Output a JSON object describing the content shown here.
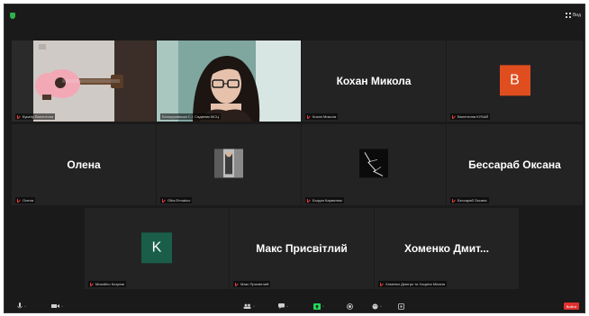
{
  "header": {
    "view_label": "Вид"
  },
  "participants": [
    {
      "id": "p1",
      "caption": "Кушнір Валентина",
      "display": "video",
      "muted": true
    },
    {
      "id": "p2",
      "caption": "Білоцерківська С.І. Садівник МСЦ",
      "display": "video",
      "muted": false,
      "active": true
    },
    {
      "id": "p3",
      "caption": "Кохан Микола",
      "display": "name",
      "name": "Кохан Микола",
      "muted": true
    },
    {
      "id": "p4",
      "caption": "Валентина КУБАЙ",
      "display": "avatar",
      "avatar_letter": "В",
      "avatar_color": "#e04e1f",
      "muted": true
    },
    {
      "id": "p5",
      "caption": "Олена",
      "display": "name",
      "name": "Олена",
      "muted": true
    },
    {
      "id": "p6",
      "caption": "Olha Ermakov",
      "display": "thumb",
      "muted": true
    },
    {
      "id": "p7",
      "caption": "Богдан Кармелюк",
      "display": "thumb",
      "muted": true
    },
    {
      "id": "p8",
      "caption": "Бессараб Оксана",
      "display": "name",
      "name": "Бессараб Оксана",
      "muted": true
    },
    {
      "id": "p9",
      "caption": "Михайло Козуляк",
      "display": "avatar",
      "avatar_letter": "K",
      "avatar_color": "#1a5e4a",
      "muted": true
    },
    {
      "id": "p10",
      "caption": "Макс Присвітлий",
      "display": "name",
      "name": "Макс Присвітлий",
      "muted": true
    },
    {
      "id": "p11",
      "caption": "Хоменко Дмитро та Хоцкіна Мілана",
      "display": "name",
      "name": "Хоменко  Дмит...",
      "muted": true
    }
  ],
  "toolbar": {
    "leave_label": "Вийти"
  },
  "colors": {
    "window_bg": "#1a1a1a",
    "tile_bg": "#232323",
    "active_border": "#c9e65a",
    "leave": "#e0302e"
  }
}
